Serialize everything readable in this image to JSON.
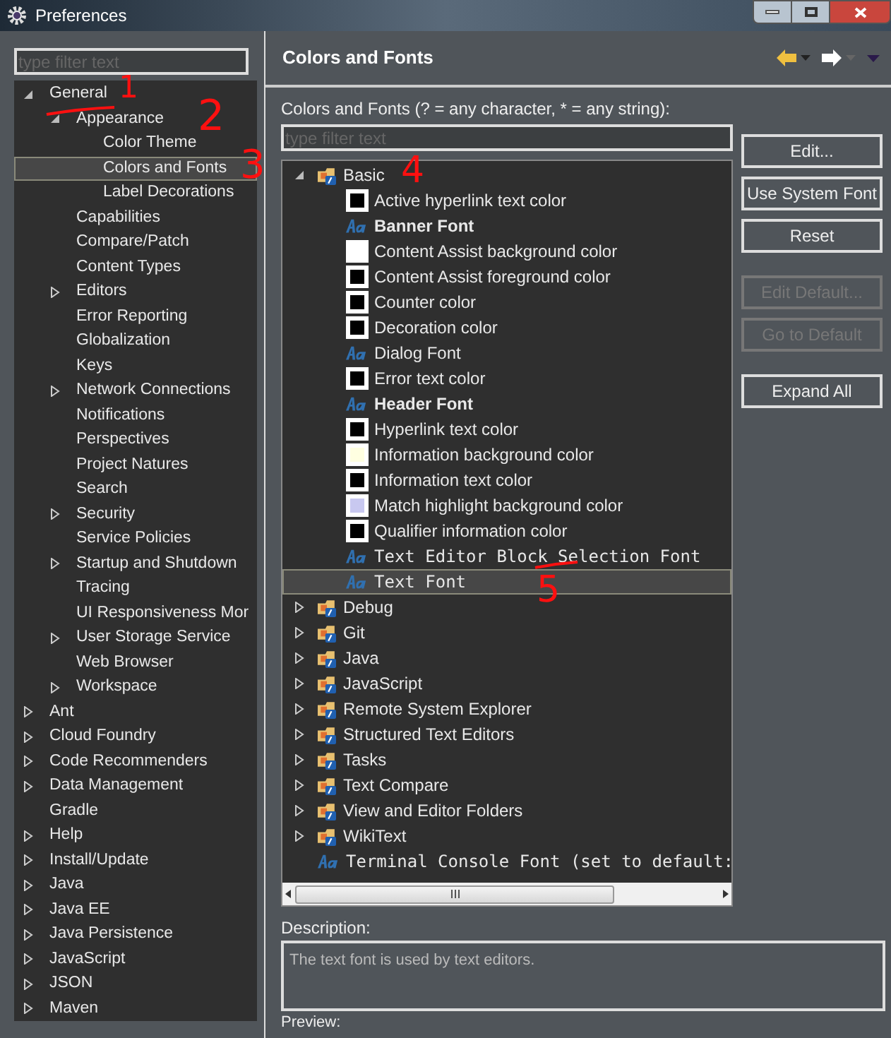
{
  "window": {
    "title": "Preferences"
  },
  "sidebar": {
    "filter": {
      "placeholder": "type filter text"
    },
    "items": [
      {
        "label": "General",
        "expanded": true,
        "selected": false,
        "children": [
          {
            "label": "Appearance",
            "expanded": true,
            "selected": false,
            "children": [
              {
                "label": "Color Theme",
                "selected": false
              },
              {
                "label": "Colors and Fonts",
                "selected": true
              },
              {
                "label": "Label Decorations",
                "selected": false
              }
            ]
          },
          {
            "label": "Capabilities",
            "selected": false
          },
          {
            "label": "Compare/Patch",
            "selected": false
          },
          {
            "label": "Content Types",
            "selected": false
          },
          {
            "label": "Editors",
            "expanded": false,
            "selected": false
          },
          {
            "label": "Error Reporting",
            "selected": false
          },
          {
            "label": "Globalization",
            "selected": false
          },
          {
            "label": "Keys",
            "selected": false
          },
          {
            "label": "Network Connections",
            "expanded": false,
            "selected": false
          },
          {
            "label": "Notifications",
            "selected": false
          },
          {
            "label": "Perspectives",
            "selected": false
          },
          {
            "label": "Project Natures",
            "selected": false
          },
          {
            "label": "Search",
            "selected": false
          },
          {
            "label": "Security",
            "expanded": false,
            "selected": false
          },
          {
            "label": "Service Policies",
            "selected": false
          },
          {
            "label": "Startup and Shutdown",
            "expanded": false,
            "selected": false
          },
          {
            "label": "Tracing",
            "selected": false
          },
          {
            "label": "UI Responsiveness Mor",
            "selected": false
          },
          {
            "label": "User Storage Service",
            "expanded": false,
            "selected": false
          },
          {
            "label": "Web Browser",
            "selected": false
          },
          {
            "label": "Workspace",
            "expanded": false,
            "selected": false
          }
        ]
      },
      {
        "label": "Ant",
        "expanded": false,
        "selected": false
      },
      {
        "label": "Cloud Foundry",
        "expanded": false,
        "selected": false
      },
      {
        "label": "Code Recommenders",
        "expanded": false,
        "selected": false
      },
      {
        "label": "Data Management",
        "expanded": false,
        "selected": false
      },
      {
        "label": "Gradle",
        "selected": false
      },
      {
        "label": "Help",
        "expanded": false,
        "selected": false
      },
      {
        "label": "Install/Update",
        "expanded": false,
        "selected": false
      },
      {
        "label": "Java",
        "expanded": false,
        "selected": false
      },
      {
        "label": "Java EE",
        "expanded": false,
        "selected": false
      },
      {
        "label": "Java Persistence",
        "expanded": false,
        "selected": false
      },
      {
        "label": "JavaScript",
        "expanded": false,
        "selected": false
      },
      {
        "label": "JSON",
        "expanded": false,
        "selected": false
      },
      {
        "label": "Maven",
        "expanded": false,
        "selected": false
      }
    ]
  },
  "page": {
    "title": "Colors and Fonts",
    "filter_label": "Colors and Fonts (? = any character, * = any string):",
    "filter": {
      "placeholder": "type filter text"
    },
    "tree": [
      {
        "kind": "category",
        "label": "Basic",
        "expanded": true,
        "selected": false,
        "children": [
          {
            "kind": "color",
            "label": "Active hyperlink text color",
            "color": "#000000",
            "selected": false
          },
          {
            "kind": "boldfont",
            "label": "Banner Font",
            "selected": false
          },
          {
            "kind": "color",
            "label": "Content Assist background color",
            "color": "#ffffff",
            "selected": false
          },
          {
            "kind": "color",
            "label": "Content Assist foreground color",
            "color": "#000000",
            "selected": false
          },
          {
            "kind": "color",
            "label": "Counter color",
            "color": "#000000",
            "selected": false
          },
          {
            "kind": "color",
            "label": "Decoration color",
            "color": "#000000",
            "selected": false
          },
          {
            "kind": "font",
            "label": "Dialog Font",
            "selected": false
          },
          {
            "kind": "color",
            "label": "Error text color",
            "color": "#000000",
            "selected": false
          },
          {
            "kind": "boldfont",
            "label": "Header Font",
            "selected": false
          },
          {
            "kind": "color",
            "label": "Hyperlink text color",
            "color": "#000000",
            "selected": false
          },
          {
            "kind": "color",
            "label": "Information background color",
            "color": "#ffffe1",
            "selected": false
          },
          {
            "kind": "color",
            "label": "Information text color",
            "color": "#000000",
            "selected": false
          },
          {
            "kind": "color",
            "label": "Match highlight background color",
            "color": "#c8c8f0",
            "selected": false
          },
          {
            "kind": "color",
            "label": "Qualifier information color",
            "color": "#000000",
            "selected": false
          },
          {
            "kind": "monofont",
            "label": "Text Editor Block Selection Font",
            "selected": false
          },
          {
            "kind": "monofont",
            "label": "Text Font",
            "selected": true
          }
        ]
      },
      {
        "kind": "category",
        "label": "Debug",
        "expanded": false,
        "selected": false
      },
      {
        "kind": "category",
        "label": "Git",
        "expanded": false,
        "selected": false
      },
      {
        "kind": "category",
        "label": "Java",
        "expanded": false,
        "selected": false
      },
      {
        "kind": "category",
        "label": "JavaScript",
        "expanded": false,
        "selected": false
      },
      {
        "kind": "category",
        "label": "Remote System Explorer",
        "expanded": false,
        "selected": false
      },
      {
        "kind": "category",
        "label": "Structured Text Editors",
        "expanded": false,
        "selected": false
      },
      {
        "kind": "category",
        "label": "Tasks",
        "expanded": false,
        "selected": false
      },
      {
        "kind": "category",
        "label": "Text Compare",
        "expanded": false,
        "selected": false
      },
      {
        "kind": "category",
        "label": "View and Editor Folders",
        "expanded": false,
        "selected": false
      },
      {
        "kind": "category",
        "label": "WikiText",
        "expanded": false,
        "selected": false
      },
      {
        "kind": "monofont",
        "label": "Terminal Console Font (set to default:",
        "selected": false
      }
    ],
    "button_groups": [
      [
        {
          "label": "Edit...",
          "disabled": false
        },
        {
          "label": "Use System Font",
          "disabled": false
        },
        {
          "label": "Reset",
          "disabled": false
        }
      ],
      [
        {
          "label": "Edit Default...",
          "disabled": true
        },
        {
          "label": "Go to Default",
          "disabled": true
        }
      ],
      [
        {
          "label": "Expand All",
          "disabled": false
        }
      ]
    ],
    "description_label": "Description:",
    "description": "The text font is used by text editors.",
    "preview_label": "Preview:"
  },
  "annotations": [
    {
      "label": "1"
    },
    {
      "label": "2"
    },
    {
      "label": "3"
    },
    {
      "label": "4"
    },
    {
      "label": "5"
    }
  ]
}
